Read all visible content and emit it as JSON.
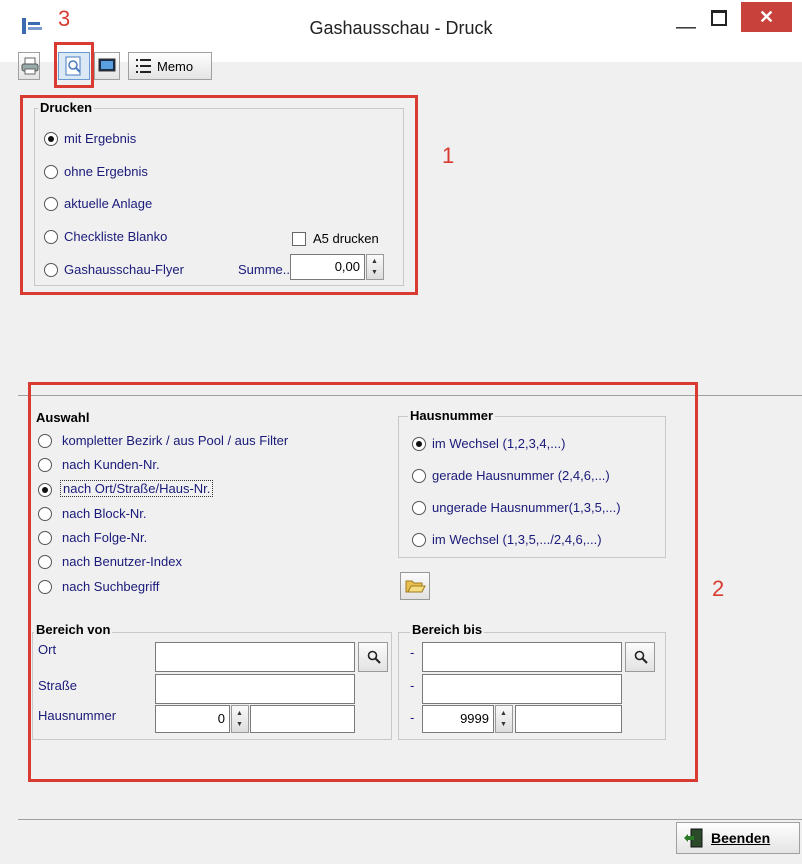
{
  "window": {
    "title": "Gashausschau - Druck",
    "close_label": "✕"
  },
  "annotations": {
    "n1": "1",
    "n2": "2",
    "n3": "3"
  },
  "toolbar": {
    "memo_label": "Memo"
  },
  "drucken": {
    "title": "Drucken",
    "options": [
      "mit Ergebnis",
      "ohne Ergebnis",
      "aktuelle Anlage",
      "Checkliste Blanko",
      "Gashausschau-Flyer"
    ],
    "selected_index": 0,
    "a5_label": "A5 drucken",
    "a5_checked": false,
    "summe_label": "Summe...",
    "summe_value": "0,00"
  },
  "auswahl": {
    "title": "Auswahl",
    "options": [
      "kompletter Bezirk / aus Pool / aus Filter",
      "nach Kunden-Nr.",
      "nach Ort/Straße/Haus-Nr.",
      "nach Block-Nr.",
      "nach Folge-Nr.",
      "nach Benutzer-Index",
      "nach Suchbegriff"
    ],
    "selected_index": 2
  },
  "hausnummer": {
    "title": "Hausnummer",
    "options": [
      "im Wechsel (1,2,3,4,...)",
      "gerade Hausnummer (2,4,6,...)",
      "ungerade Hausnummer(1,3,5,...)",
      "im Wechsel (1,3,5,.../2,4,6,...)"
    ],
    "selected_index": 0
  },
  "bereich_von": {
    "title": "Bereich von",
    "ort_label": "Ort",
    "strasse_label": "Straße",
    "hausnummer_label": "Hausnummer",
    "ort_value": "",
    "strasse_value": "",
    "hausnummer_value": "0",
    "hausnummer_suffix": ""
  },
  "bereich_bis": {
    "title": "Bereich bis",
    "dash1": "-",
    "dash2": "-",
    "dash3": "-",
    "ort_value": "",
    "strasse_value": "",
    "hausnummer_value": "9999",
    "hausnummer_suffix": ""
  },
  "footer": {
    "beenden_label": "Beenden"
  },
  "colors": {
    "annotation_red": "#d83b32",
    "close_red": "#c8413a",
    "label_blue": "#1a1a7a"
  }
}
